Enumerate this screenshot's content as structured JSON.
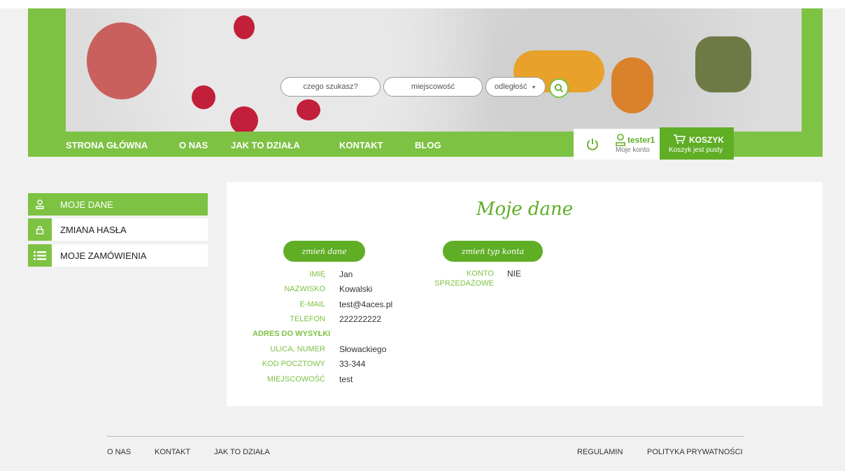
{
  "search": {
    "what_placeholder": "czego szukasz?",
    "where_placeholder": "miejscowość",
    "distance_value": "odległość"
  },
  "nav": [
    "STRONA GŁÓWNA",
    "O NAS",
    "JAK TO DZIAŁA",
    "KONTAKT",
    "BLOG"
  ],
  "user": {
    "name": "tester1",
    "sub": "Moje konto"
  },
  "cart": {
    "title": "KOSZYK",
    "sub": "Koszyk jest pusty"
  },
  "sidebar": [
    {
      "label": "MOJE DANE",
      "icon": "user-icon",
      "active": true
    },
    {
      "label": "ZMIANA HASŁA",
      "icon": "lock-icon",
      "active": false
    },
    {
      "label": "MOJE ZAMÓWIENIA",
      "icon": "list-icon",
      "active": false
    }
  ],
  "main": {
    "title": "Moje dane",
    "edit_button": "zmień dane",
    "type_button": "zmień typ konta",
    "fields": [
      {
        "label": "IMIĘ",
        "value": "Jan"
      },
      {
        "label": "NAZWISKO",
        "value": "Kowalski"
      },
      {
        "label": "E-MAIL",
        "value": "test@4aces.pl"
      },
      {
        "label": "TELEFON",
        "value": "222222222"
      }
    ],
    "address_heading": "ADRES DO WYSYŁKI",
    "address_fields": [
      {
        "label": "ULICA, NUMER",
        "value": "Słowackiego"
      },
      {
        "label": "KOD POCZTOWY",
        "value": "33-344"
      },
      {
        "label": "MIEJSCOWOŚĆ",
        "value": "test"
      }
    ],
    "account_label": "KONTO SPRZEDAŻOWE",
    "account_value": "NIE"
  },
  "footer": {
    "left": [
      "O NAS",
      "KONTAKT",
      "JAK TO DZIAŁA"
    ],
    "right": [
      "REGULAMIN",
      "POLITYKA PRYWATNOŚCI"
    ]
  },
  "colors": {
    "brand_green": "#7dc243",
    "dark_green": "#5fae26"
  }
}
